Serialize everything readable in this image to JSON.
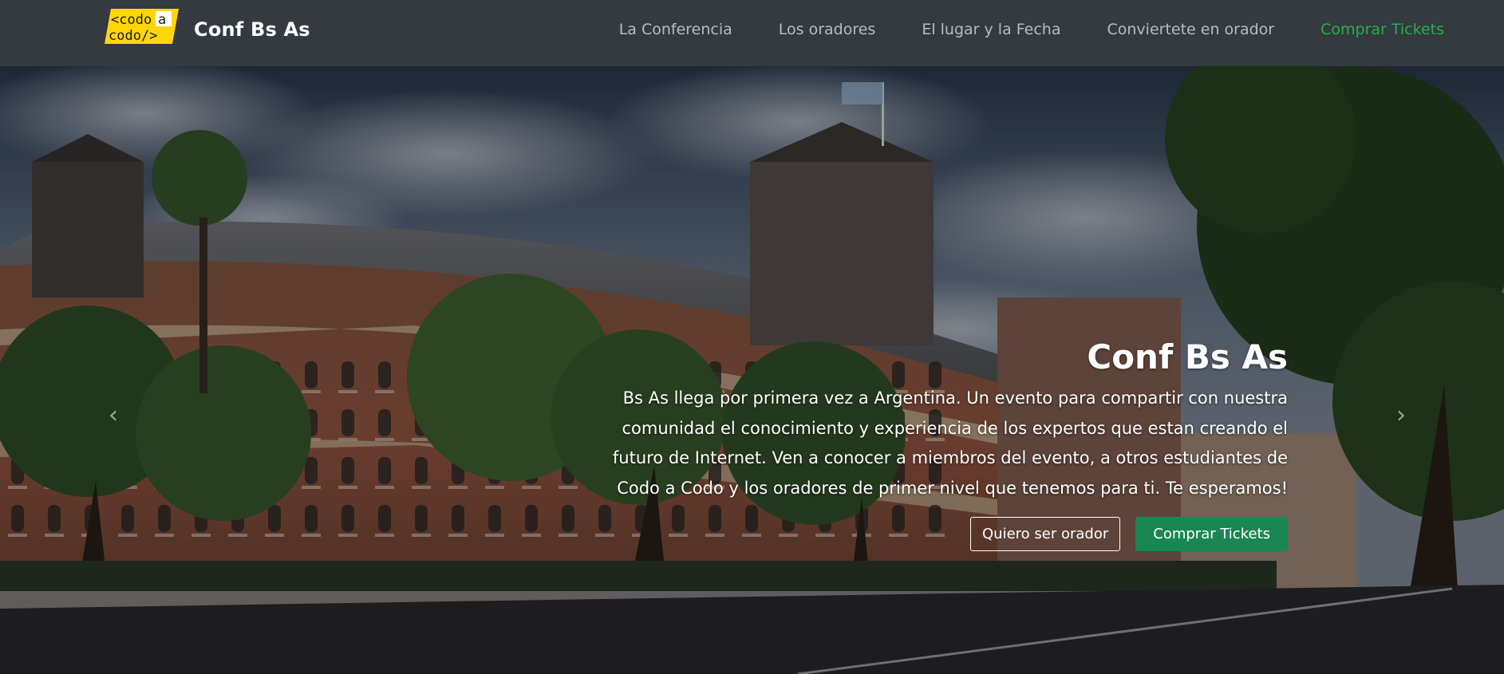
{
  "navbar": {
    "logo": {
      "line1": "<codo",
      "line1_accent": "a",
      "line2": "codo/>",
      "icon": "codo-a-codo-logo"
    },
    "brand": "Conf Bs As",
    "links": [
      {
        "label": "La Conferencia"
      },
      {
        "label": "Los oradores"
      },
      {
        "label": "El lugar y la Fecha"
      },
      {
        "label": "Conviertete en orador"
      },
      {
        "label": "Comprar Tickets",
        "accent": true
      }
    ]
  },
  "hero": {
    "title": "Conf Bs As",
    "description": "Bs As llega por primera vez a Argentina. Un evento para compartir con nuestra comunidad el conocimiento y experiencia de los expertos que estan creando el futuro de Internet. Ven a conocer a miembros del evento, a otros estudiantes de Codo a Codo y los oradores de primer nivel que tenemos para ti. Te esperamos!",
    "buttons": {
      "speaker": "Quiero ser orador",
      "tickets": "Comprar Tickets"
    },
    "controls": {
      "prev_icon": "chevron-left-icon",
      "next_icon": "chevron-right-icon"
    }
  },
  "colors": {
    "navbar_bg": "#343a40",
    "nav_link": "#b7bcc1",
    "nav_accent": "#27ae4b",
    "logo_yellow": "#ffd60a",
    "button_success": "#198754"
  }
}
